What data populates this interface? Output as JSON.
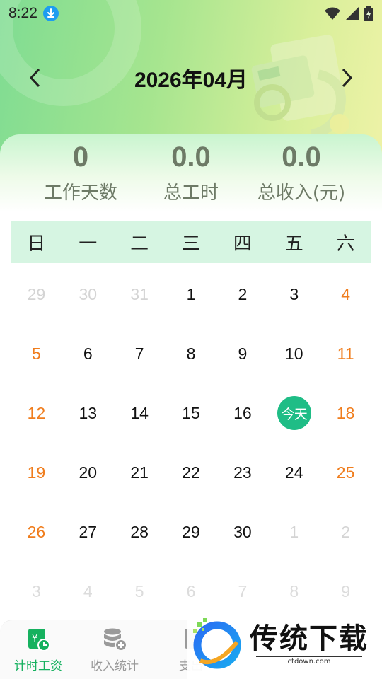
{
  "status_bar": {
    "time": "8:22",
    "icons": [
      "download-icon",
      "wifi-icon",
      "signal-icon",
      "battery-icon"
    ]
  },
  "calendar_header": {
    "title": "2026年04月",
    "prev_icon": "chevron-left-icon",
    "next_icon": "chevron-right-icon"
  },
  "stats": [
    {
      "value": "0",
      "label": "工作天数"
    },
    {
      "value": "0.0",
      "label": "总工时"
    },
    {
      "value": "0.0",
      "label": "总收入(元)"
    }
  ],
  "weekdays": [
    "日",
    "一",
    "二",
    "三",
    "四",
    "五",
    "六"
  ],
  "weeks": [
    [
      {
        "d": "29",
        "t": "other"
      },
      {
        "d": "30",
        "t": "other"
      },
      {
        "d": "31",
        "t": "other"
      },
      {
        "d": "1",
        "t": "normal"
      },
      {
        "d": "2",
        "t": "normal"
      },
      {
        "d": "3",
        "t": "normal"
      },
      {
        "d": "4",
        "t": "weekend"
      }
    ],
    [
      {
        "d": "5",
        "t": "weekend"
      },
      {
        "d": "6",
        "t": "normal"
      },
      {
        "d": "7",
        "t": "normal"
      },
      {
        "d": "8",
        "t": "normal"
      },
      {
        "d": "9",
        "t": "normal"
      },
      {
        "d": "10",
        "t": "normal"
      },
      {
        "d": "11",
        "t": "weekend"
      }
    ],
    [
      {
        "d": "12",
        "t": "weekend"
      },
      {
        "d": "13",
        "t": "normal"
      },
      {
        "d": "14",
        "t": "normal"
      },
      {
        "d": "15",
        "t": "normal"
      },
      {
        "d": "16",
        "t": "normal"
      },
      {
        "d": "今天",
        "t": "today"
      },
      {
        "d": "18",
        "t": "weekend"
      }
    ],
    [
      {
        "d": "19",
        "t": "weekend"
      },
      {
        "d": "20",
        "t": "normal"
      },
      {
        "d": "21",
        "t": "normal"
      },
      {
        "d": "22",
        "t": "normal"
      },
      {
        "d": "23",
        "t": "normal"
      },
      {
        "d": "24",
        "t": "normal"
      },
      {
        "d": "25",
        "t": "weekend"
      }
    ],
    [
      {
        "d": "26",
        "t": "weekend"
      },
      {
        "d": "27",
        "t": "normal"
      },
      {
        "d": "28",
        "t": "normal"
      },
      {
        "d": "29",
        "t": "normal"
      },
      {
        "d": "30",
        "t": "normal"
      },
      {
        "d": "1",
        "t": "other"
      },
      {
        "d": "2",
        "t": "other"
      }
    ],
    [
      {
        "d": "3",
        "t": "other"
      },
      {
        "d": "4",
        "t": "other"
      },
      {
        "d": "5",
        "t": "other"
      },
      {
        "d": "6",
        "t": "other"
      },
      {
        "d": "7",
        "t": "other"
      },
      {
        "d": "8",
        "t": "other"
      },
      {
        "d": "9",
        "t": "other"
      }
    ]
  ],
  "bottom_nav": {
    "tabs": [
      {
        "label": "计时工资",
        "icon": "wage-icon",
        "active": true
      },
      {
        "label": "收入统计",
        "icon": "database-add-icon",
        "active": false
      },
      {
        "label": "支出",
        "icon": "expense-icon",
        "active": false
      }
    ]
  },
  "watermark": {
    "title": "传统下载",
    "url": "ctdown.com"
  },
  "colors": {
    "weekend": "#f07d1d",
    "today": "#1fbd86",
    "active_tab": "#16b15f",
    "weekday_bg": "#d6f5e2"
  }
}
